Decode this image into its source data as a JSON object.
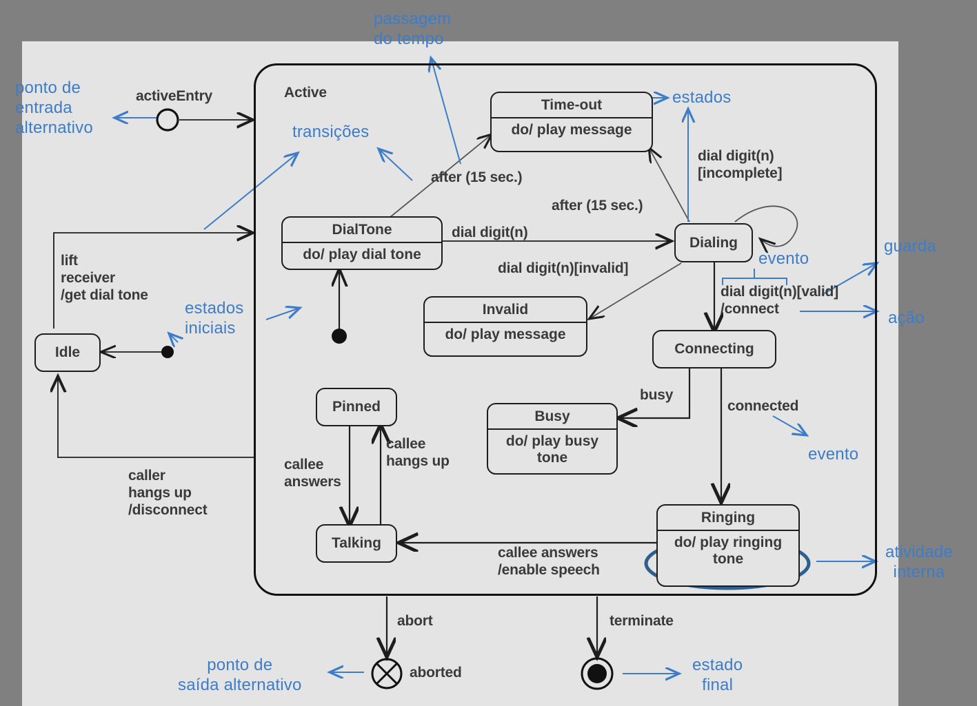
{
  "diagram": {
    "title": "Active",
    "background_color": "#e4e4e4",
    "outer_frame_color": "#808080",
    "note_color": "#3d7cc9",
    "line_color": "#1d1d1d"
  },
  "composite_state": {
    "name": "Active"
  },
  "states": {
    "idle": {
      "name": "Idle"
    },
    "dialtone": {
      "name": "DialTone",
      "activity": "do/ play dial tone"
    },
    "timeout": {
      "name": "Time-out",
      "activity": "do/ play message"
    },
    "invalid": {
      "name": "Invalid",
      "activity": "do/ play message"
    },
    "dialing": {
      "name": "Dialing"
    },
    "connecting": {
      "name": "Connecting"
    },
    "busy": {
      "name": "Busy",
      "activity": "do/ play busy\ntone"
    },
    "ringing": {
      "name": "Ringing",
      "activity": "do/ play ringing\ntone"
    },
    "pinned": {
      "name": "Pinned"
    },
    "talking": {
      "name": "Talking"
    }
  },
  "pseudostates": {
    "active_entry": "activeEntry",
    "aborted_exit": "aborted"
  },
  "transitions": {
    "lift_receiver": "lift\nreceiver\n/get dial tone",
    "caller_hangs_up": "caller\nhangs up\n/disconnect",
    "after_15_a": "after (15 sec.)",
    "after_15_b": "after (15 sec.)",
    "dial_digit": "dial digit(n)",
    "dial_digit_invalid": "dial digit(n)[invalid]",
    "dial_digit_incomplete": "dial digit(n)\n[incomplete]",
    "dial_digit_valid": "dial digit(n)[valid]\n/connect",
    "busy": "busy",
    "connected": "connected",
    "callee_answers_speech": "callee answers\n/enable speech",
    "callee_answers": "callee\nanswers",
    "callee_hangs_up": "callee\nhangs up",
    "abort": "abort",
    "terminate": "terminate"
  },
  "annotations": {
    "entry_point": "ponto de\nentrada\nalternativo",
    "time_passage": "passagem\ndo tempo",
    "transitions": "transições",
    "states_right": "estados",
    "initial_states": "estados\niniciais",
    "guard": "guarda",
    "event_right": "evento",
    "action": "ação",
    "event_lower": "evento",
    "internal_activity": "atividade\ninterna",
    "exit_point": "ponto de\nsaída alternativo",
    "final_state": "estado\nfinal"
  }
}
